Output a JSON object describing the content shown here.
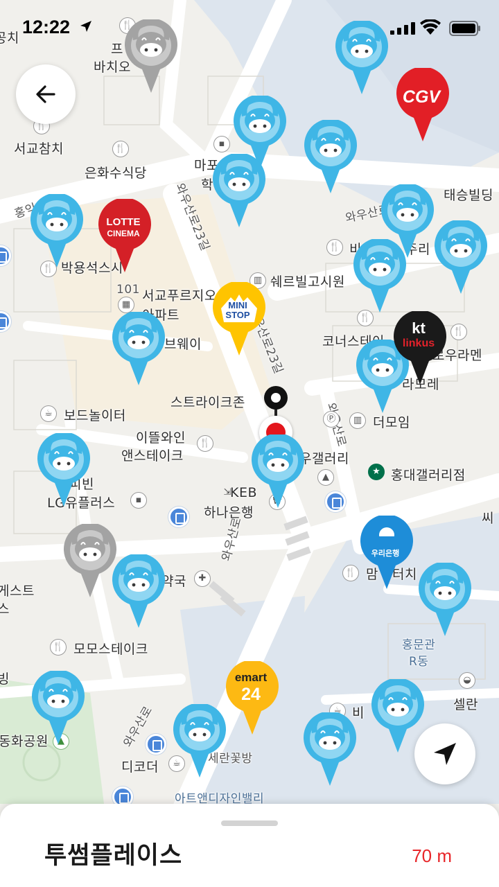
{
  "status_bar": {
    "time": "12:22",
    "location_icon": "location-arrow-icon",
    "signal_icon": "cellular-signal-icon",
    "wifi_icon": "wifi-icon",
    "battery_icon": "battery-icon"
  },
  "controls": {
    "back_icon": "back-arrow-icon",
    "locate_icon": "navigation-arrow-icon"
  },
  "map": {
    "road_labels": [
      "와우산로23길",
      "와우산로23길",
      "와우산로21길",
      "와우산로",
      "와우산로",
      "홍익",
      "와우산로",
      "우산로23길"
    ],
    "poi_labels": {
      "bachi": "바치오",
      "pu": "프",
      "seogyo_chamchi": "서교참치",
      "eunhwasu": "은화수식당",
      "mapo": "마포",
      "hak": "학",
      "taeseung": "태승빌딩",
      "park_yongseok": "박용석스시",
      "b_ju": "비",
      "juri": "주리",
      "sherbill": "쉐르빌고시원",
      "seogyo_apt_101": "101",
      "seogyo_apt": "서교푸르지오",
      "apt": "아파트",
      "subway": "브웨이",
      "corner": "코너스테이",
      "wooramen": "로우라멘",
      "tomore": "라모레",
      "strikezone": "스트라이크존",
      "board": "보드놀이터",
      "ittle_wine": "이뜰와인",
      "n_steak": "앤스테이크",
      "gallery": "우갤러리",
      "the_moim": "더모임",
      "starbucks": "홍대갤러리점",
      "kebin": "피빈",
      "lg_plus": "LG유플러스",
      "keb": "KEB",
      "hana": "하나은행",
      "yakguk": "약국",
      "mam_bu": "맘",
      "teochi": "터치",
      "guesthouse1": "게스트",
      "guesthouse2": "스",
      "momo": "모모스테이크",
      "hongmun1": "홍문관",
      "hongmun2": "R동",
      "ssi": "씨",
      "selan": "셀란",
      "bing": "빙",
      "bi2": "비",
      "park": "동화공원",
      "decoder": "디코더",
      "flower": "세란꽃방",
      "art_design": "아트앤디자인밸리",
      "gongchi": "공치"
    },
    "brand_pins": {
      "cgv": "CGV",
      "lotte_1": "LOTTE",
      "lotte_2": "CINEMA",
      "ministop_1": "MINI",
      "ministop_2": "STOP",
      "kt_1": "kt",
      "kt_2": "linkus",
      "woori": "우리은행",
      "emart_1": "emart",
      "emart_2": "24"
    },
    "pin_icon": "cow-mascot-pin-icon",
    "colors": {
      "pin_blue": "#3fb6e6",
      "pin_gray": "#a3a3a3",
      "cgv": "#e21f26",
      "lotte": "#d42027",
      "ministop": "#ffc400",
      "kt": "#1a1a1a",
      "woori": "#1e8dd8",
      "emart": "#fdb913"
    }
  },
  "sheet": {
    "place_name": "투썸플레이스",
    "distance": "70 m"
  }
}
